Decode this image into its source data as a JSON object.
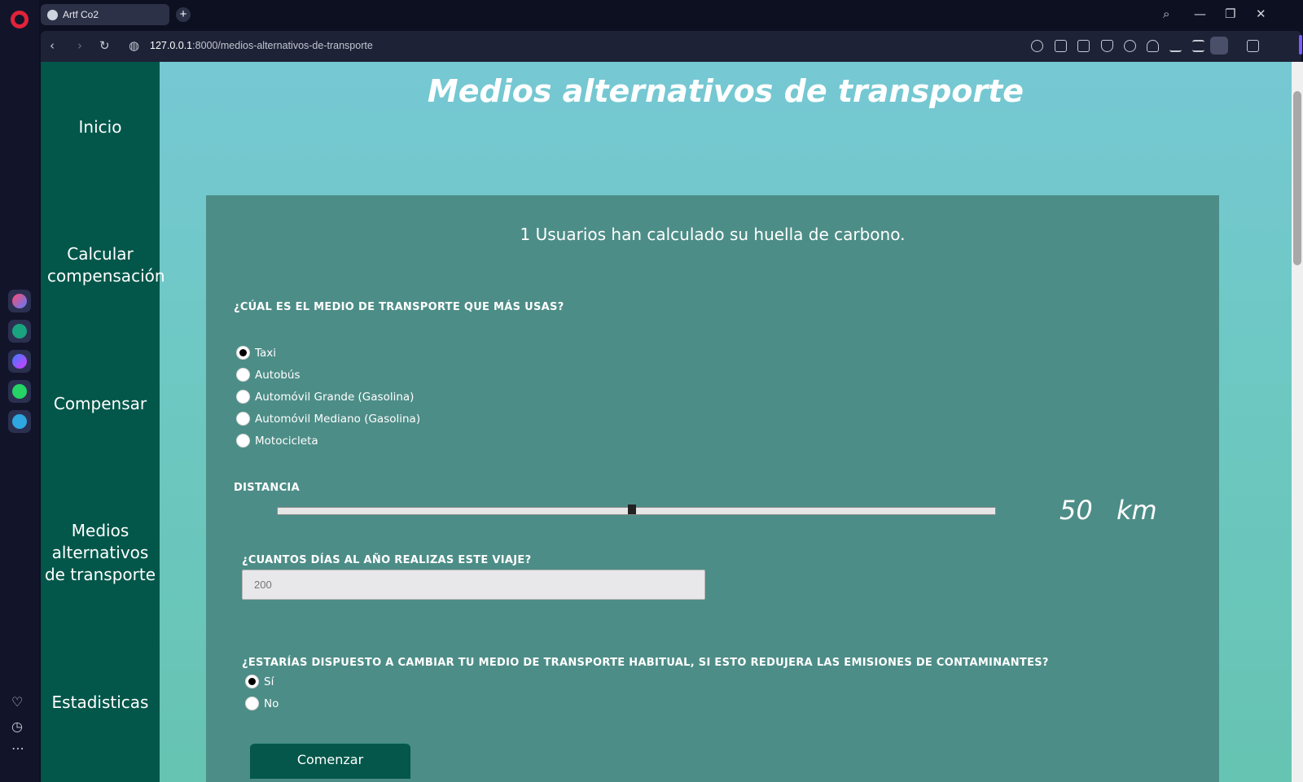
{
  "browser": {
    "tab_title": "Artf Co2",
    "new_tab": "+",
    "url_host": "127.0.0.1",
    "url_path": ":8000/medios-alternativos-de-transporte",
    "window_controls": {
      "search": "⌕",
      "minimize": "—",
      "restore": "❐",
      "close": "✕"
    },
    "nav": {
      "back": "‹",
      "forward": "›",
      "reload": "↻",
      "site_info": "◍"
    },
    "rail_bottom": {
      "heart": "♡",
      "history": "◷",
      "more": "⋯"
    }
  },
  "sidebar": {
    "items": [
      {
        "label": "Inicio"
      },
      {
        "label": "Calcular compensación"
      },
      {
        "label": "Compensar"
      },
      {
        "label": "Medios alternativos de transporte"
      },
      {
        "label": "Estadisticas"
      }
    ]
  },
  "main": {
    "title": "Medios alternativos de transporte",
    "counter_text": "1 Usuarios han calculado su huella de carbono.",
    "transport_question": "¿CÚAL ES EL MEDIO DE TRANSPORTE QUE MÁS USAS?",
    "transport_options": [
      "Taxi",
      "Autobús",
      "Automóvil Grande (Gasolina)",
      "Automóvil Mediano (Gasolina)",
      "Motocicleta"
    ],
    "transport_selected": "Taxi",
    "distance_label": "DISTANCIA",
    "distance_value": "50",
    "distance_unit": "km",
    "days_question": "¿CUANTOS DÍAS AL AÑO REALIZAS ESTE VIAJE?",
    "days_placeholder": "200",
    "change_question": "¿ESTARÍAS DISPUESTO A CAMBIAR TU MEDIO DE TRANSPORTE HABITUAL, SI ESTO REDUJERA LAS EMISIONES DE CONTAMINANTES?",
    "change_options": [
      "Sí",
      "No"
    ],
    "change_selected": "Sí",
    "start_button": "Comenzar"
  },
  "colors": {
    "sidebar_bg": "#02574a",
    "card_bg": "#4d8d87",
    "page_bg": "#76c8d3"
  }
}
